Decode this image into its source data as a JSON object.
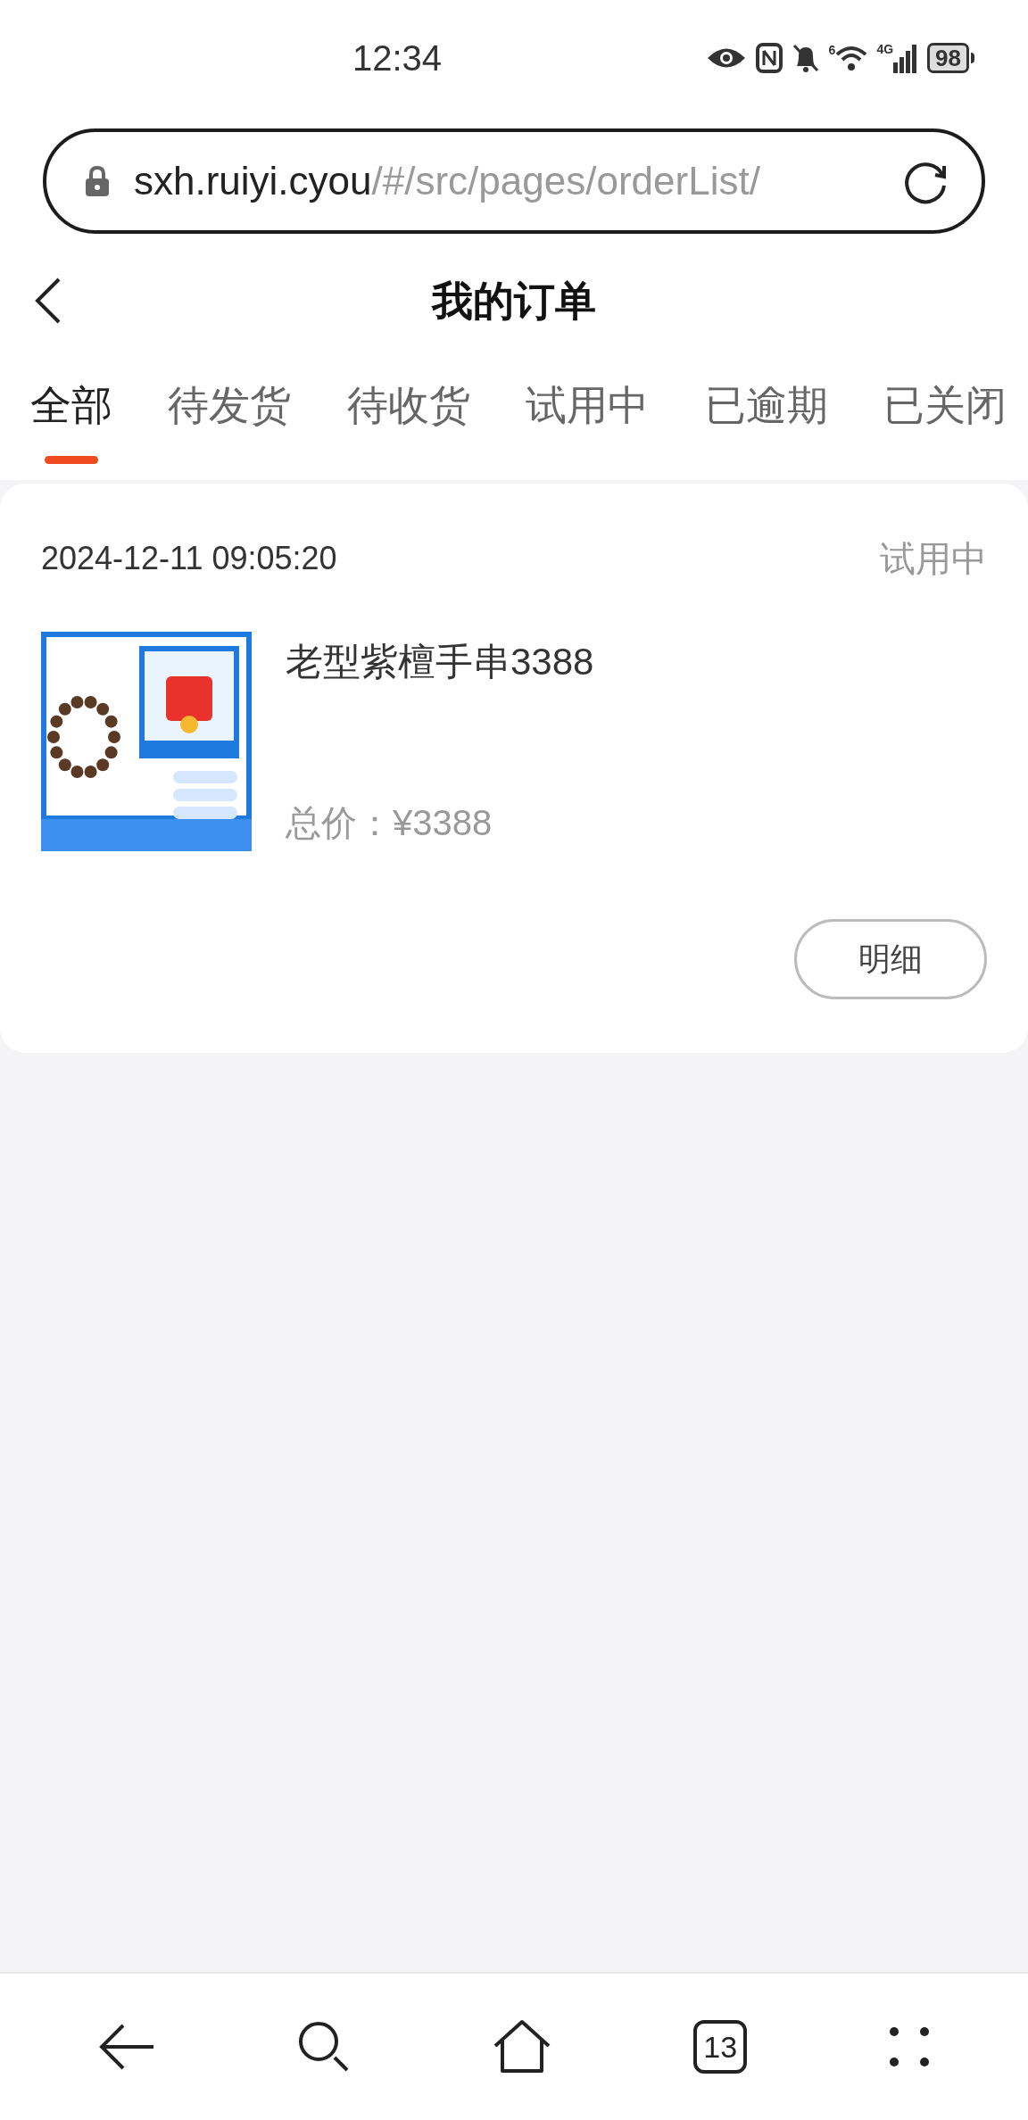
{
  "status_bar": {
    "time": "12:34",
    "network": "4G",
    "wifi_badge": "6",
    "battery": "98"
  },
  "address_bar": {
    "domain": "sxh.ruiyi.cyou",
    "path": "/#/src/pages/orderList/"
  },
  "header": {
    "title": "我的订单"
  },
  "tabs": [
    {
      "label": "全部",
      "selected": true
    },
    {
      "label": "待发货",
      "selected": false
    },
    {
      "label": "待收货",
      "selected": false
    },
    {
      "label": "试用中",
      "selected": false
    },
    {
      "label": "已逾期",
      "selected": false
    },
    {
      "label": "已关闭",
      "selected": false
    }
  ],
  "orders": [
    {
      "time": "2024-12-11 09:05:20",
      "status": "试用中",
      "product_name": "老型紫檀手串3388",
      "total": "总价：¥3388",
      "button": "明细"
    }
  ],
  "bottom_nav": {
    "tab_count": "13"
  }
}
